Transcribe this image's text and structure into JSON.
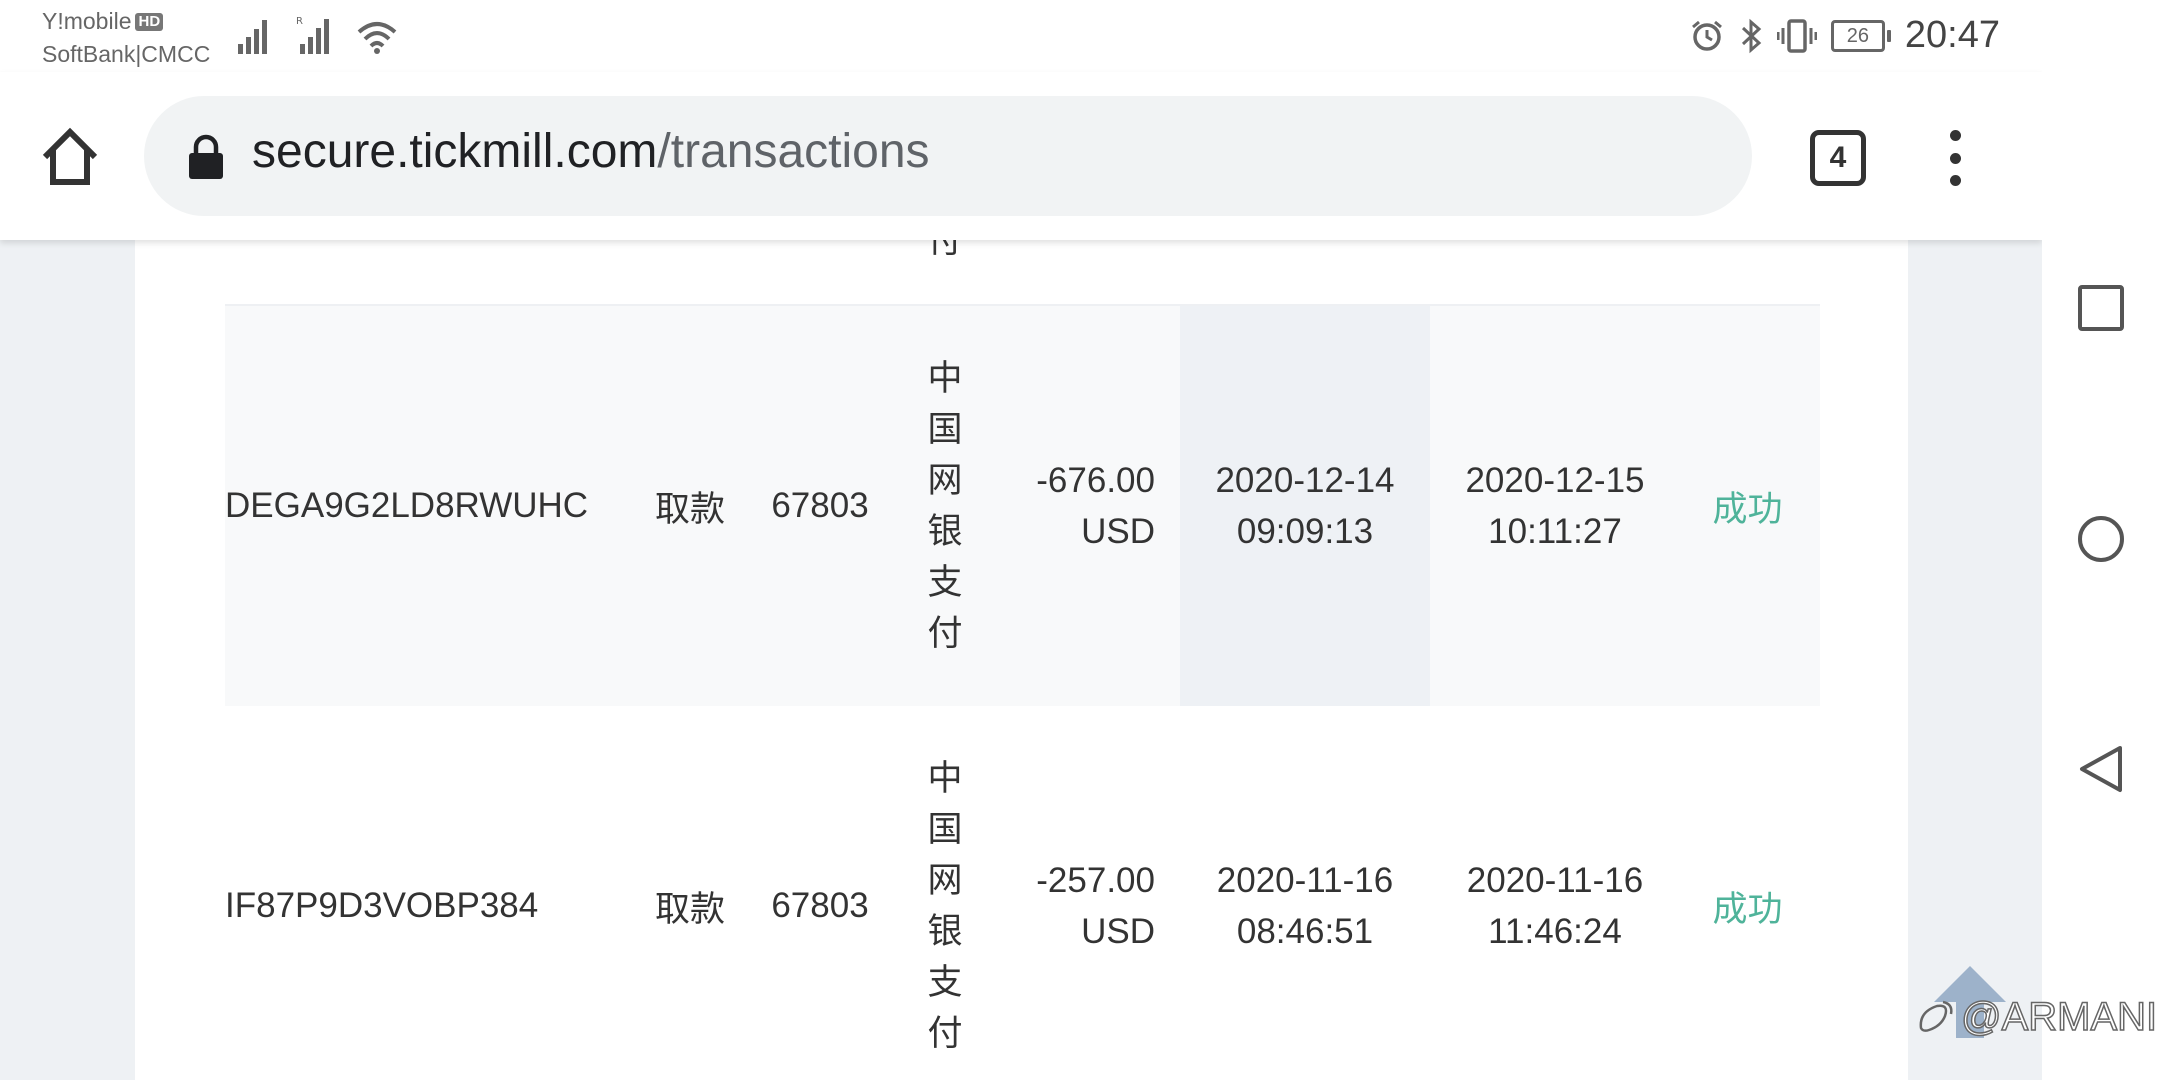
{
  "status_bar": {
    "carrier_top": "Y!mobile",
    "hd_badge": "HD",
    "carrier_bottom": "SoftBank|CMCC",
    "battery": "26",
    "time": "20:47"
  },
  "browser": {
    "url_host": "secure.tickmill.com",
    "url_path": "/transactions",
    "tab_count": "4",
    "icons": [
      "home-icon",
      "lock-icon",
      "tabs-icon",
      "menu-icon"
    ]
  },
  "table": {
    "partial_top_char": "付",
    "rows": [
      {
        "id": "DEGA9G2LD8RWUHC",
        "type": "取款",
        "account": "67803",
        "method_chars": [
          "中",
          "国",
          "网",
          "银",
          "支",
          "付"
        ],
        "amount_value": "-676.00",
        "amount_currency": "USD",
        "created_date": "2020-12-14",
        "created_time": "09:09:13",
        "processed_date": "2020-12-15",
        "processed_time": "10:11:27",
        "status": "成功"
      },
      {
        "id": "IF87P9D3VOBP384",
        "type": "取款",
        "account": "67803",
        "method_chars": [
          "中",
          "国",
          "网",
          "银",
          "支",
          "付"
        ],
        "amount_value": "-257.00",
        "amount_currency": "USD",
        "created_date": "2020-11-16",
        "created_time": "08:46:51",
        "processed_date": "2020-11-16",
        "processed_time": "11:46:24",
        "status": "成功"
      }
    ]
  },
  "colors": {
    "success": "#4fb39a",
    "page_bg": "#eef1f4",
    "row_alt": "#f8f9fa",
    "highlight_cell": "#eef1f5"
  },
  "nav_icons": [
    "recents-square-icon",
    "home-circle-icon",
    "back-triangle-icon"
  ],
  "watermark": "@ARMANI"
}
